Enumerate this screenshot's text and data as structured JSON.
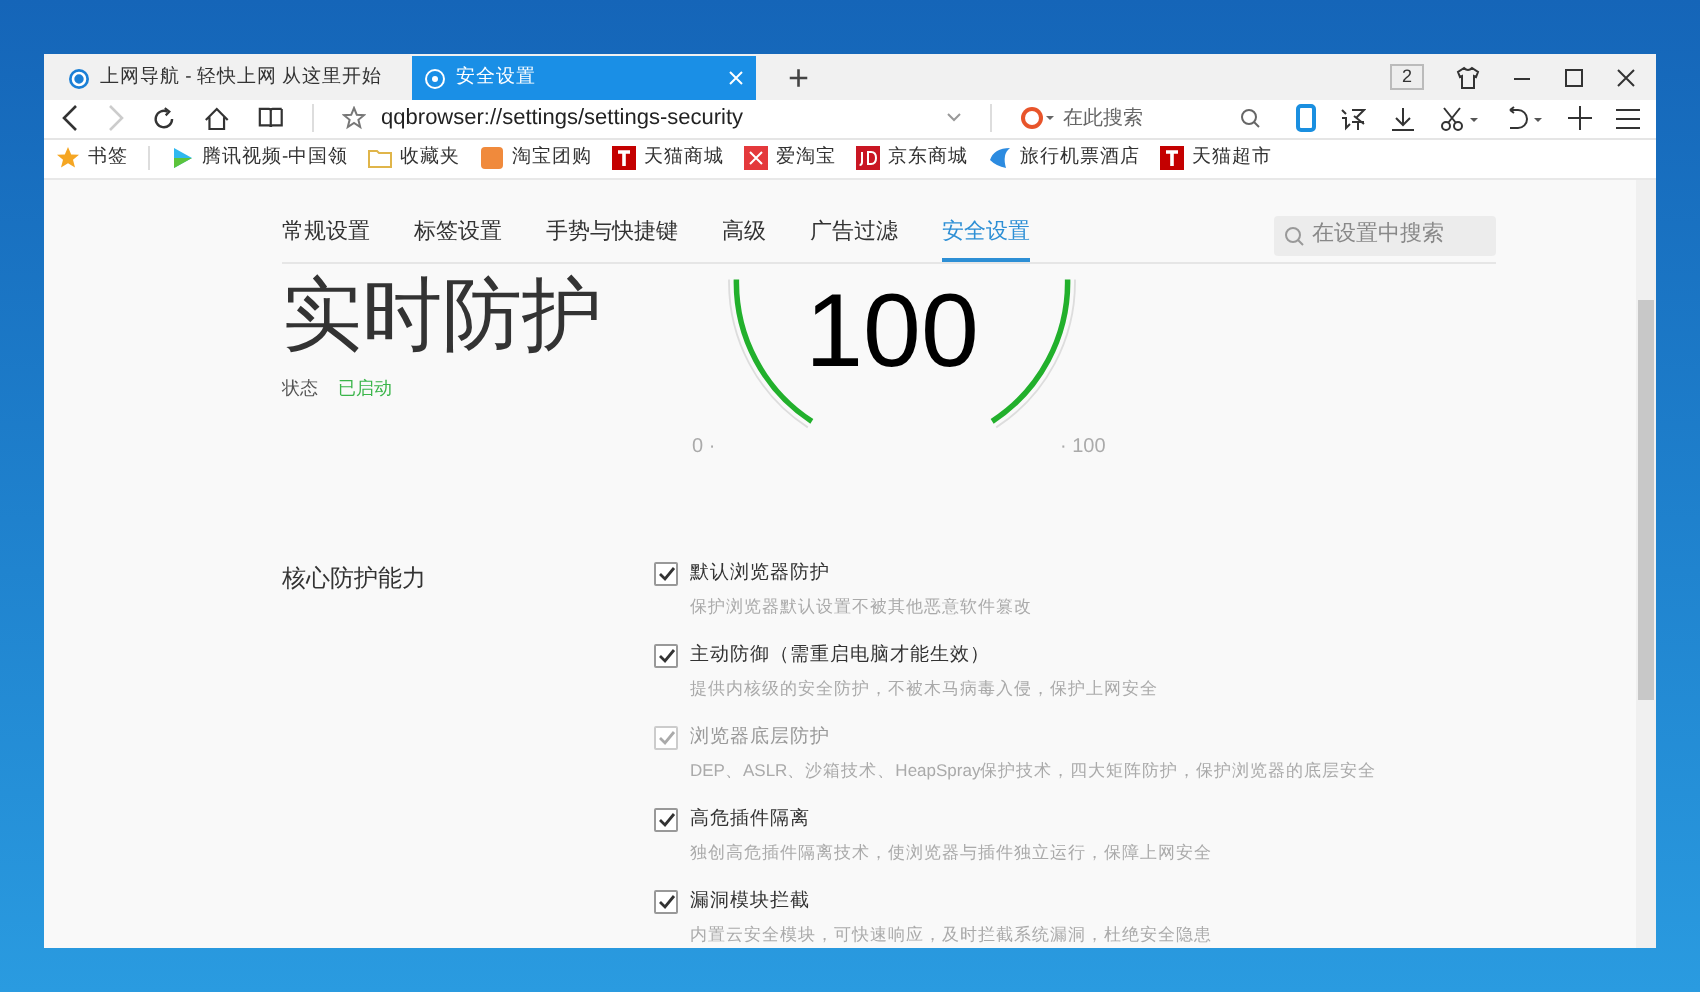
{
  "browser_tabs": [
    {
      "title": "上网导航 - 轻快上网 从这里开始",
      "selected": false,
      "closable": false
    },
    {
      "title": "安全设置",
      "selected": true,
      "closable": true
    }
  ],
  "new_tab": "+",
  "window_count": "2",
  "address_bar": {
    "url": "qqbrowser://settings/settings-security",
    "back_disabled": false,
    "forward_disabled": true
  },
  "search_box": {
    "placeholder": "在此搜索"
  },
  "bookmarks": [
    {
      "label": "书签",
      "kind": "star"
    },
    {
      "label": "腾讯视频-中国领",
      "kind": "play"
    },
    {
      "label": "收藏夹",
      "kind": "folder"
    },
    {
      "label": "淘宝团购",
      "kind": "tao"
    },
    {
      "label": "天猫商城",
      "kind": "tmall"
    },
    {
      "label": "爱淘宝",
      "kind": "ai"
    },
    {
      "label": "京东商城",
      "kind": "jd"
    },
    {
      "label": "旅行机票酒店",
      "kind": "travel"
    },
    {
      "label": "天猫超市",
      "kind": "tmall"
    }
  ],
  "settings_tabs": [
    {
      "label": "常规设置",
      "selected": false
    },
    {
      "label": "标签设置",
      "selected": false
    },
    {
      "label": "手势与快捷键",
      "selected": false
    },
    {
      "label": "高级",
      "selected": false
    },
    {
      "label": "广告过滤",
      "selected": false
    },
    {
      "label": "安全设置",
      "selected": true
    }
  ],
  "settings_search": {
    "placeholder": "在设置中搜索"
  },
  "protection": {
    "title": "实时防护",
    "status_label": "状态",
    "status": "已启动",
    "score": "100",
    "scale_min": "0 ·",
    "scale_max": "· 100",
    "level": 1
  },
  "core": {
    "heading": "核心防护能力",
    "options": [
      {
        "label": "默认浏览器防护",
        "description": "保护浏览器默认设置不被其他恶意软件篡改",
        "checked": true,
        "disabled": false
      },
      {
        "label": "主动防御（需重启电脑才能生效）",
        "description": "提供内核级的安全防护，不被木马病毒入侵，保护上网安全",
        "checked": true,
        "disabled": false
      },
      {
        "label": "浏览器底层防护",
        "description": "DEP、ASLR、沙箱技术、HeapSpray保护技术，四大矩阵防护，保护浏览器的底层安全",
        "checked": true,
        "disabled": true
      },
      {
        "label": "高危插件隔离",
        "description": "独创高危插件隔离技术，使浏览器与插件独立运行，保障上网安全",
        "checked": true,
        "disabled": false
      },
      {
        "label": "漏洞模块拦截",
        "description": "内置云安全模块，可快速响应，及时拦截系统漏洞，杜绝安全隐患",
        "checked": true,
        "disabled": false
      }
    ]
  }
}
